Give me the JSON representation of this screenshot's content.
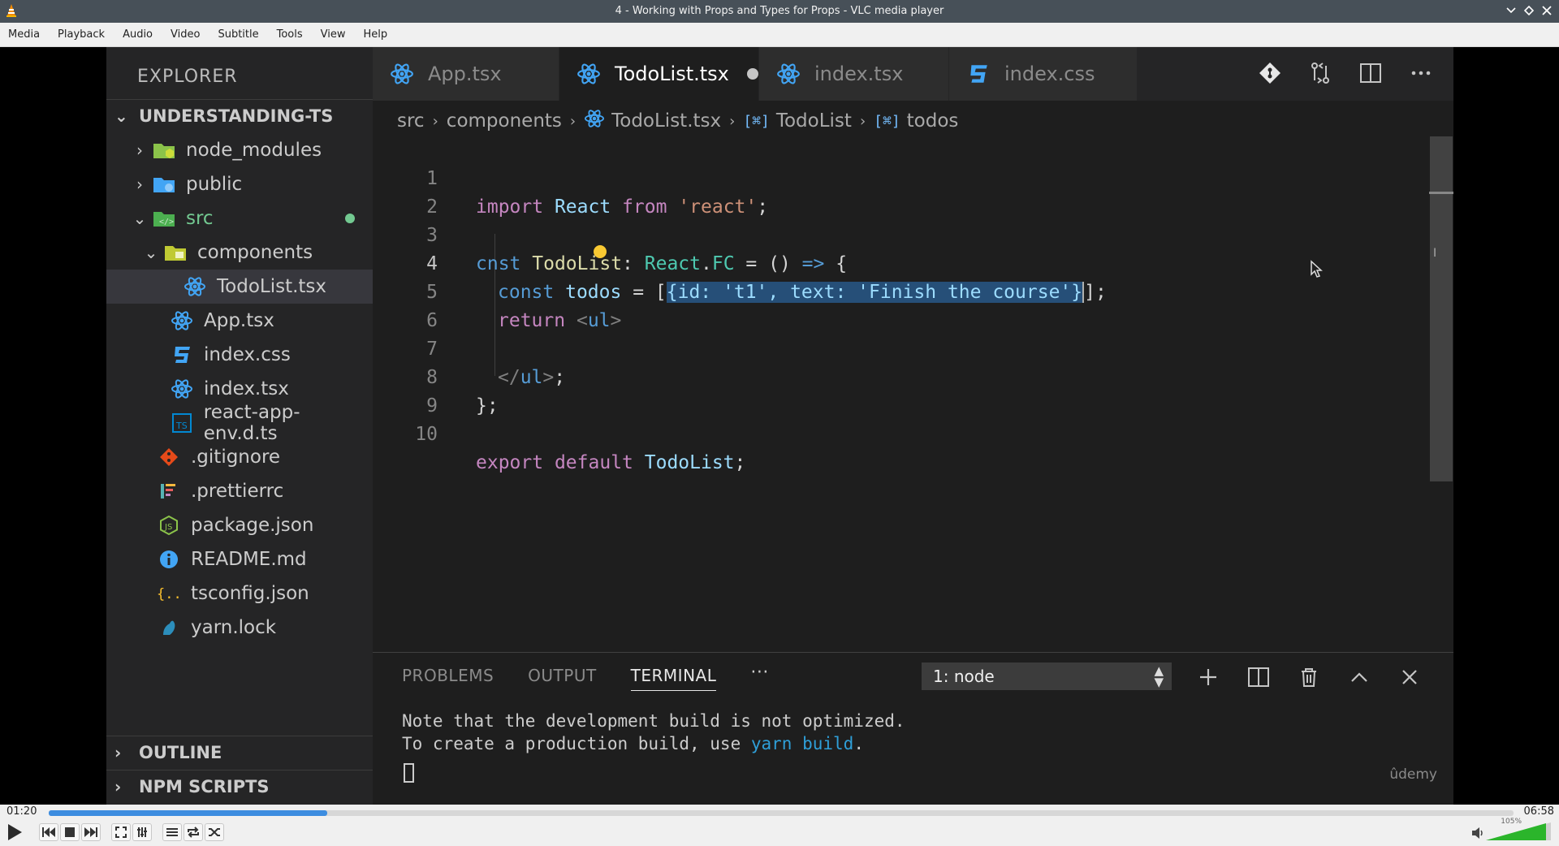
{
  "window": {
    "title": "4 - Working with Props and Types for Props - VLC media player"
  },
  "menu": [
    "Media",
    "Playback",
    "Audio",
    "Video",
    "Subtitle",
    "Tools",
    "View",
    "Help"
  ],
  "explorer": {
    "title": "EXPLORER",
    "project": "UNDERSTANDING-TS",
    "items": [
      {
        "label": "node_modules",
        "icon": "folder-node-icon",
        "color": "#8bc34a"
      },
      {
        "label": "public",
        "icon": "folder-public-icon",
        "color": "#42a5f5"
      },
      {
        "label": "src",
        "icon": "folder-src-icon",
        "color": "#4caf50"
      },
      {
        "label": "components",
        "icon": "folder-components-icon",
        "color": "#c0ca33"
      },
      {
        "label": "TodoList.tsx",
        "icon": "react-icon",
        "color": "#42a5f5"
      },
      {
        "label": "App.tsx",
        "icon": "react-icon",
        "color": "#42a5f5"
      },
      {
        "label": "index.css",
        "icon": "css-icon",
        "color": "#42a5f5"
      },
      {
        "label": "index.tsx",
        "icon": "react-icon",
        "color": "#42a5f5"
      },
      {
        "label": "react-app-env.d.ts",
        "icon": "typescript-icon",
        "color": "#0288d1"
      },
      {
        "label": ".gitignore",
        "icon": "git-icon",
        "color": "#e64a19"
      },
      {
        "label": ".prettierrc",
        "icon": "prettier-icon",
        "color": "#56b3b4"
      },
      {
        "label": "package.json",
        "icon": "nodejs-icon",
        "color": "#8bc34a"
      },
      {
        "label": "README.md",
        "icon": "info-icon",
        "color": "#42a5f5"
      },
      {
        "label": "tsconfig.json",
        "icon": "json-icon",
        "color": "#fbc02d"
      },
      {
        "label": "yarn.lock",
        "icon": "yarn-icon",
        "color": "#2c8ebb"
      }
    ],
    "outline": "OUTLINE",
    "npm_scripts": "NPM SCRIPTS"
  },
  "tabs": [
    {
      "label": "App.tsx",
      "icon": "react-icon"
    },
    {
      "label": "TodoList.tsx",
      "icon": "react-icon",
      "active": true,
      "dirty": true
    },
    {
      "label": "index.tsx",
      "icon": "react-icon"
    },
    {
      "label": "index.css",
      "icon": "css-icon"
    }
  ],
  "breadcrumb": [
    "src",
    "components",
    "TodoList.tsx",
    "TodoList",
    "todos"
  ],
  "line_numbers": [
    "1",
    "2",
    "3",
    "4",
    "5",
    "6",
    "7",
    "8",
    "9",
    "10"
  ],
  "code": {
    "l1": [
      "import",
      "React",
      "from",
      "'react'",
      ";"
    ],
    "l3": [
      "c",
      "nst",
      "TodoList",
      ":",
      "React",
      ".",
      "FC",
      " = () ",
      "=>",
      " {"
    ],
    "l4": [
      "const",
      "todos",
      "= [",
      "{id: 't1', text: 'Finish the course'}",
      "]",
      ";"
    ],
    "l5": [
      "return",
      "<",
      "ul",
      ">"
    ],
    "l7": [
      "</",
      "ul",
      ">",
      ";"
    ],
    "l8": "};",
    "l10": [
      "export",
      "default",
      "TodoList",
      ";"
    ]
  },
  "panel": {
    "tabs": [
      "PROBLEMS",
      "OUTPUT",
      "TERMINAL"
    ],
    "more": "···",
    "terminal_select": "1: node",
    "terminal_lines": [
      "Note that the development build is not optimized.",
      "To create a production build, use ",
      "yarn build",
      "."
    ],
    "watermark": "ûdemy"
  },
  "player": {
    "elapsed": "01:20",
    "total": "06:58",
    "progress": 0.19,
    "volume_pct": "105%"
  },
  "colors": {
    "accent": "#3d8de0",
    "editor_bg": "#1e1e1e",
    "sidebar_bg": "#252526"
  }
}
